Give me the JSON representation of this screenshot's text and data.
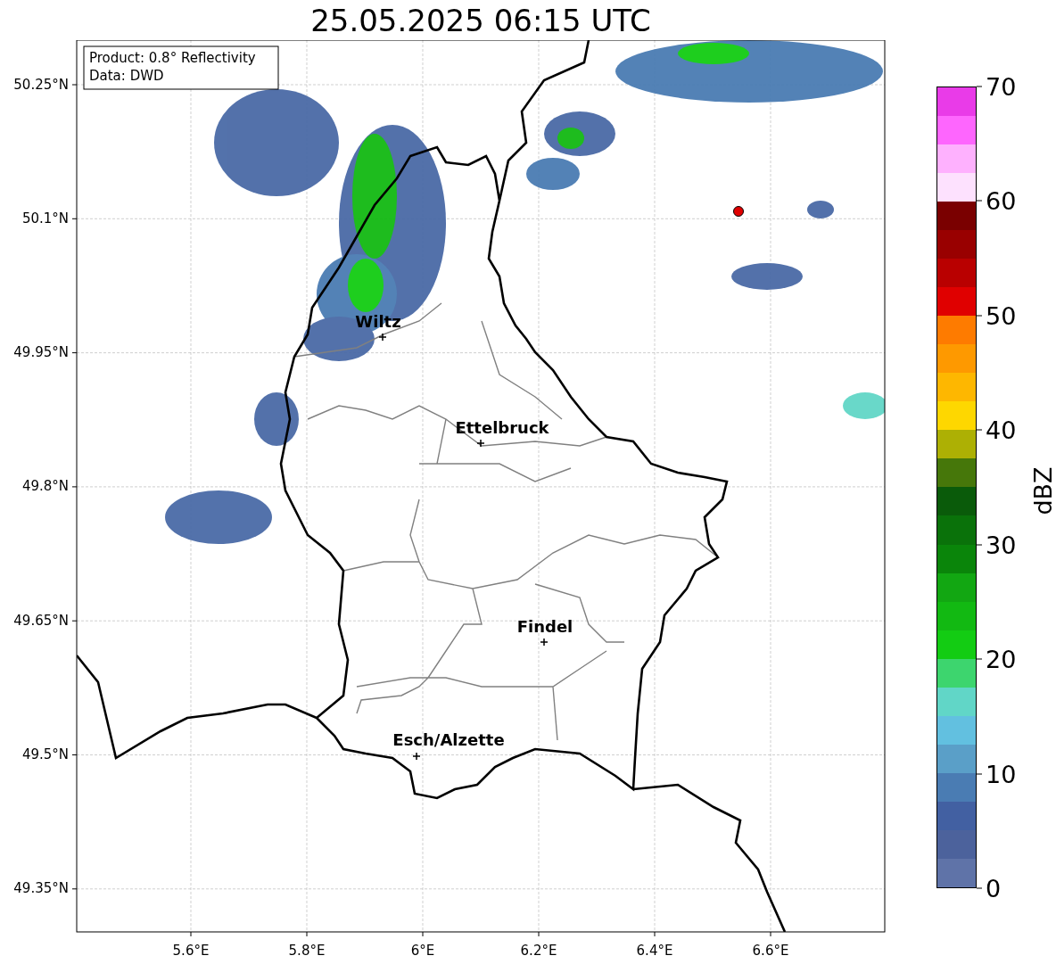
{
  "title": "25.05.2025 06:15 UTC",
  "info_box": {
    "lines": [
      "Product: 0.8° Reflectivity",
      "Data: DWD"
    ]
  },
  "axes": {
    "lat_ticks": [
      "50.25°N",
      "50.1°N",
      "49.95°N",
      "49.8°N",
      "49.65°N",
      "49.5°N",
      "49.35°N"
    ],
    "lon_ticks": [
      "5.6°E",
      "5.8°E",
      "6°E",
      "6.2°E",
      "6.4°E",
      "6.6°E"
    ]
  },
  "cities": [
    {
      "name": "Wiltz"
    },
    {
      "name": "Ettelbruck"
    },
    {
      "name": "Findel"
    },
    {
      "name": "Esch/Alzette"
    }
  ],
  "colorbar": {
    "label": "dBZ",
    "ticks": [
      "70",
      "60",
      "50",
      "40",
      "30",
      "20",
      "10",
      "0"
    ],
    "bands": [
      {
        "color": "#e93be8"
      },
      {
        "color": "#fe66fe"
      },
      {
        "color": "#feb1fe"
      },
      {
        "color": "#fde1fe"
      },
      {
        "color": "#7a0000"
      },
      {
        "color": "#990000"
      },
      {
        "color": "#b90000"
      },
      {
        "color": "#e00000"
      },
      {
        "color": "#fe7b00"
      },
      {
        "color": "#fe9900"
      },
      {
        "color": "#feb700"
      },
      {
        "color": "#fed700"
      },
      {
        "color": "#adb004"
      },
      {
        "color": "#46770a"
      },
      {
        "color": "#0a5b0a"
      },
      {
        "color": "#0a720a"
      },
      {
        "color": "#0a850a"
      },
      {
        "color": "#12a712"
      },
      {
        "color": "#12b912"
      },
      {
        "color": "#13cc13"
      },
      {
        "color": "#3dd56e"
      },
      {
        "color": "#61d6c7"
      },
      {
        "color": "#62c0e0"
      },
      {
        "color": "#5a9fc8"
      },
      {
        "color": "#4a7cb3"
      },
      {
        "color": "#4260a2"
      },
      {
        "color": "#4c629c"
      },
      {
        "color": "#5f73a8"
      }
    ]
  }
}
